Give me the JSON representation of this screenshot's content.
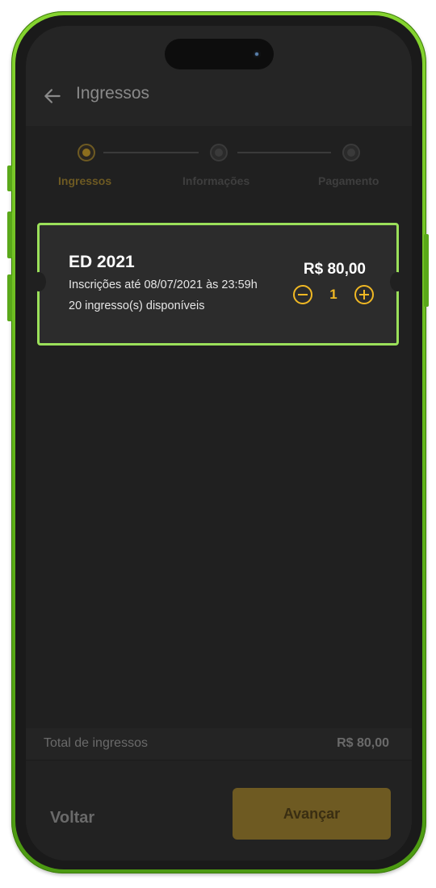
{
  "header": {
    "back_icon": "arrow-left-icon",
    "title": "Ingressos"
  },
  "stepper": {
    "steps": [
      {
        "label": "Ingressos",
        "state": "active"
      },
      {
        "label": "Informações",
        "state": "inactive"
      },
      {
        "label": "Pagamento",
        "state": "inactive"
      }
    ]
  },
  "ticket": {
    "name": "ED 2021",
    "deadline": "Inscrições até 08/07/2021 às 23:59h",
    "available": "20 ingresso(s) disponíveis",
    "price": "R$ 80,00",
    "quantity": "1",
    "minus_icon": "minus-circle-icon",
    "plus_icon": "plus-circle-icon"
  },
  "total": {
    "label": "Total de ingressos",
    "value": "R$ 80,00"
  },
  "footer": {
    "back_label": "Voltar",
    "next_label": "Avançar"
  },
  "colors": {
    "accent": "#f0b824",
    "accent_muted": "#6e5a22",
    "highlight_border": "#9be05a",
    "frame": "#6cc21f",
    "background": "#202020"
  }
}
